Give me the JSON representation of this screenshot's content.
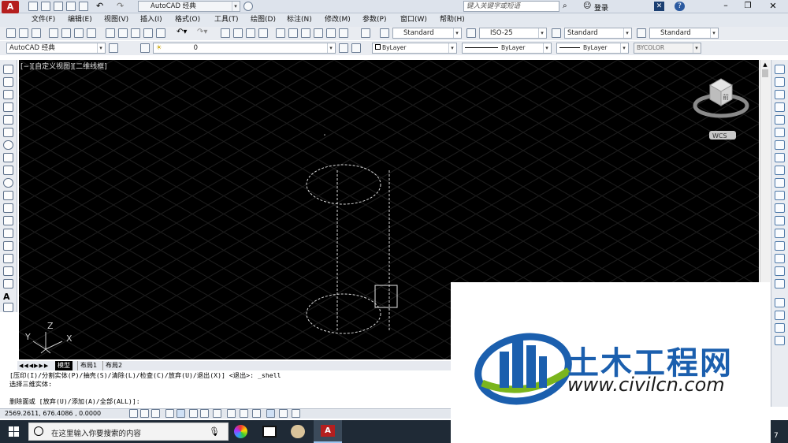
{
  "titlebar": {
    "workspace": "AutoCAD 经典",
    "search_placeholder": "键入关键字或短语",
    "login": "登录",
    "help_icon": "question-icon",
    "window_controls": [
      "minimize-icon",
      "restore-icon",
      "close-icon"
    ]
  },
  "menu": {
    "items": [
      "文件(F)",
      "编辑(E)",
      "视图(V)",
      "插入(I)",
      "格式(O)",
      "工具(T)",
      "绘图(D)",
      "标注(N)",
      "修改(M)",
      "参数(P)",
      "窗口(W)",
      "帮助(H)"
    ]
  },
  "styles": {
    "text_style": "Standard",
    "dim_style": "ISO-25",
    "table_style": "Standard",
    "mleader_style": "Standard"
  },
  "layers": {
    "workspace": "AutoCAD 经典",
    "current_layer": "0",
    "color": "ByLayer",
    "linetype": "ByLayer",
    "lineweight": "ByLayer",
    "plotstyle": "BYCOLOR"
  },
  "viewport": {
    "label": "[−][自定义视图][二维线框]",
    "ucs": "WCS",
    "axis_x": "X",
    "axis_y": "Y",
    "axis_z": "Z",
    "viewcube_face": "前"
  },
  "layout_tabs": [
    "模型",
    "布局1",
    "布局2"
  ],
  "command": {
    "line1": "[压印(I)/分割实体(P)/抽壳(S)/清除(L)/检查(C)/放弃(U)/退出(X)] <退出>: _shell",
    "line2": "选择三维实体:",
    "line3": "删除面或 [放弃(U)/添加(A)/全部(ALL)]:"
  },
  "status": {
    "coords": "2569.2611, 676.4086 , 0.0000"
  },
  "taskbar": {
    "search_placeholder": "在这里输入你要搜索的内容",
    "time": "7"
  },
  "watermark": {
    "brand": "土木工程网",
    "url": "www.civilcn.com"
  },
  "colors": {
    "canvas": "#000000",
    "grid": "#1e1e1e",
    "taskbar": "#1f2a36",
    "watermark_blue": "#1b5fae",
    "watermark_green": "#7ab51d"
  }
}
